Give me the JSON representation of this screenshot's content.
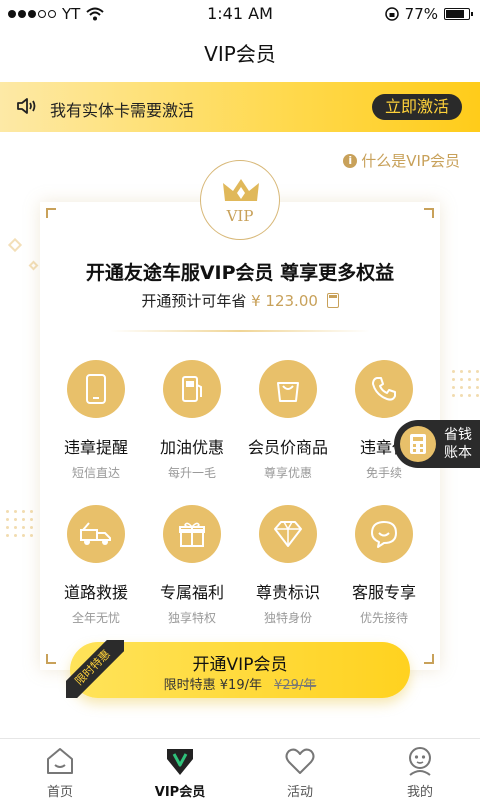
{
  "status_bar": {
    "carrier": "YT",
    "time": "1:41 AM",
    "battery": "77%",
    "signal_bars": 3
  },
  "nav": {
    "title": "VIP会员"
  },
  "banner": {
    "text": "我有实体卡需要激活",
    "button": "立即激活"
  },
  "what_is_vip": "什么是VIP会员",
  "card": {
    "badge_text": "VIP",
    "headline": "开通友途车服VIP会员  尊享更多权益",
    "savings_prefix": "开通预计可年省",
    "savings_amount": "¥ 123.00"
  },
  "benefits": [
    {
      "title": "违章提醒",
      "subtitle": "短信直达",
      "icon": "phone-device-icon"
    },
    {
      "title": "加油优惠",
      "subtitle": "每升一毛",
      "icon": "fuel-pump-icon"
    },
    {
      "title": "会员价商品",
      "subtitle": "尊享优惠",
      "icon": "shopping-bag-icon"
    },
    {
      "title": "违章代",
      "subtitle": "免手续",
      "icon": "telephone-icon"
    },
    {
      "title": "道路救援",
      "subtitle": "全年无忧",
      "icon": "tow-truck-icon"
    },
    {
      "title": "专属福利",
      "subtitle": "独享特权",
      "icon": "gift-icon"
    },
    {
      "title": "尊贵标识",
      "subtitle": "独特身份",
      "icon": "diamond-icon"
    },
    {
      "title": "客服专享",
      "subtitle": "优先接待",
      "icon": "chat-bubble-icon"
    }
  ],
  "float_book": {
    "line1": "省钱",
    "line2": "账本"
  },
  "open_button": {
    "label": "开通VIP会员",
    "price_text": "限时特惠 ¥19/年",
    "original_price": "¥29/年",
    "ribbon": "限时特惠"
  },
  "tabs": [
    {
      "label": "首页",
      "icon": "home-icon"
    },
    {
      "label": "VIP会员",
      "icon": "vip-icon",
      "active": true
    },
    {
      "label": "活动",
      "icon": "heart-icon"
    },
    {
      "label": "我的",
      "icon": "profile-icon"
    }
  ],
  "colors": {
    "gold": "#c8a15a",
    "gold_circle": "#e8c06a",
    "banner_yellow": "#ffd94d",
    "dark": "#2b2b2b",
    "vip_green": "#2fc27a"
  }
}
